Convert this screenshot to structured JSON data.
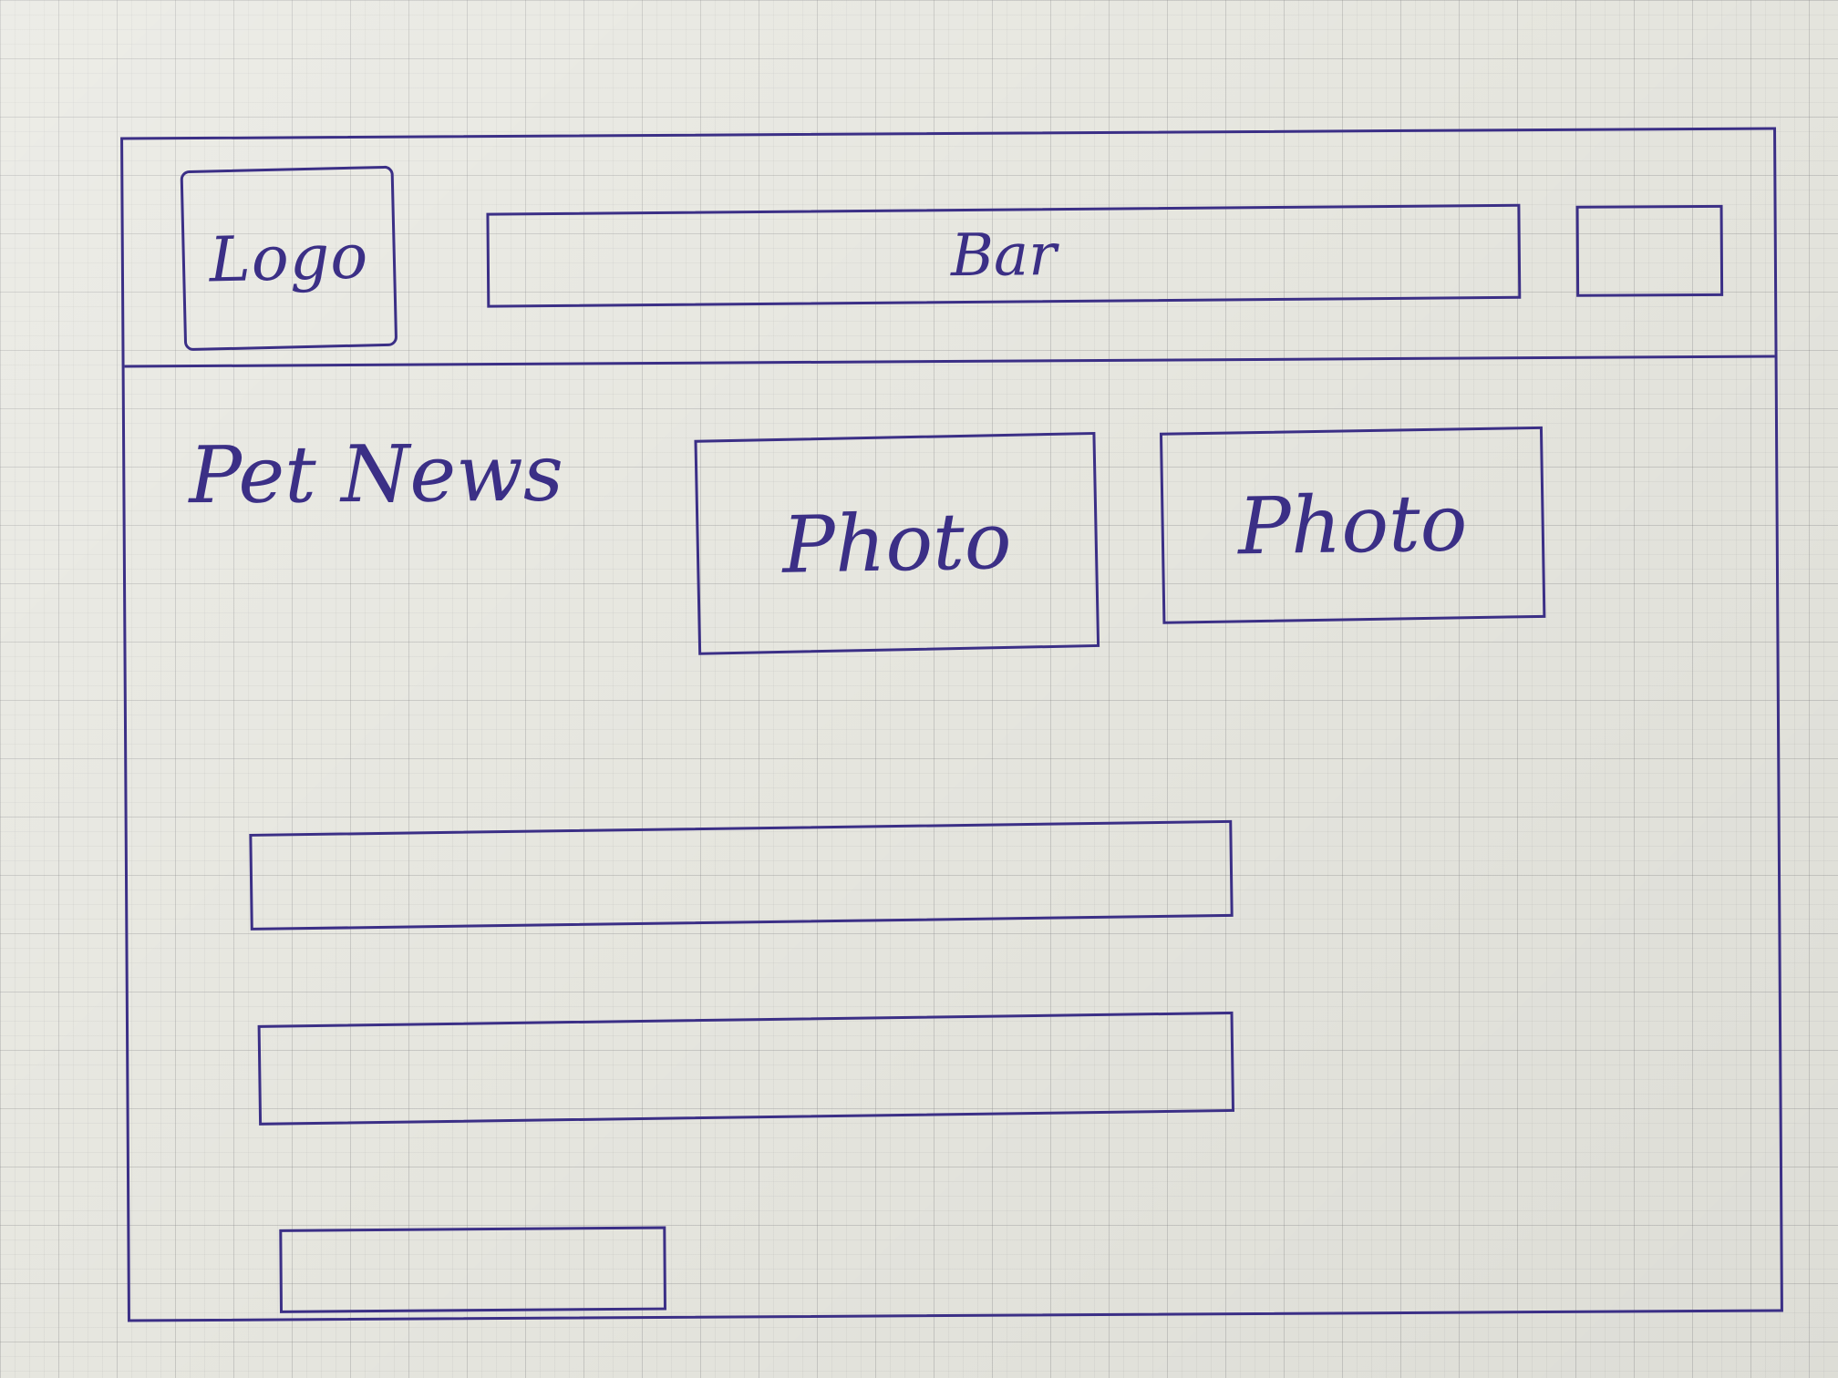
{
  "header": {
    "logo_label": "Logo",
    "search_bar_label": "Bar",
    "action_button_label": ""
  },
  "main": {
    "title": "Pet News",
    "photos": [
      {
        "label": "Photo"
      },
      {
        "label": "Photo"
      }
    ],
    "content_bars": [
      {
        "label": ""
      },
      {
        "label": ""
      }
    ],
    "bottom_button_label": ""
  },
  "colors": {
    "ink": "#3b2f86",
    "paper": "#e6e6df"
  }
}
